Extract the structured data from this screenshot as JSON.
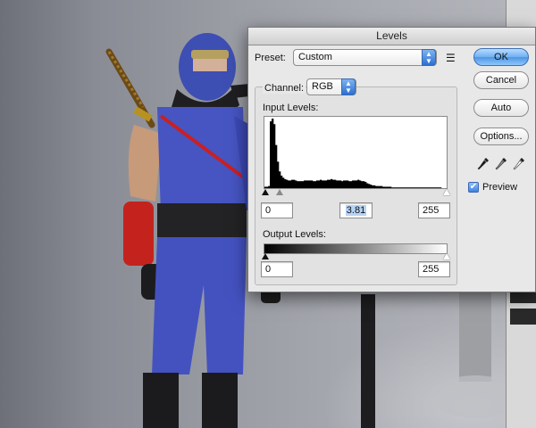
{
  "dialog": {
    "title": "Levels",
    "preset": {
      "label": "Preset:",
      "value": "Custom"
    },
    "channel": {
      "label": "Channel:",
      "value": "RGB"
    },
    "input_levels": {
      "label": "Input Levels:",
      "shadow": "0",
      "midtone": "3.81",
      "highlight": "255"
    },
    "output_levels": {
      "label": "Output Levels:",
      "shadow": "0",
      "highlight": "255"
    },
    "buttons": {
      "ok": "OK",
      "cancel": "Cancel",
      "auto": "Auto",
      "options": "Options..."
    },
    "preview": {
      "label": "Preview",
      "checked": true
    },
    "icons": {
      "preset_menu": "list-menu-icon",
      "popup_arrows": "updown-arrows-icon",
      "droppers": [
        "black-eyedropper-icon",
        "gray-eyedropper-icon",
        "white-eyedropper-icon"
      ]
    }
  },
  "histogram": {
    "bins": [
      2,
      2,
      3,
      96,
      100,
      92,
      62,
      38,
      24,
      18,
      15,
      13,
      12,
      11,
      11,
      12,
      12,
      11,
      10,
      10,
      10,
      10,
      11,
      11,
      11,
      11,
      11,
      10,
      10,
      11,
      11,
      12,
      11,
      11,
      11,
      12,
      12,
      13,
      12,
      12,
      11,
      11,
      11,
      10,
      11,
      11,
      11,
      10,
      10,
      11,
      11,
      11,
      12,
      11,
      10,
      10,
      9,
      7,
      6,
      5,
      4,
      4,
      3,
      3,
      3,
      3,
      2,
      2,
      2,
      2,
      2,
      1,
      1,
      1,
      1,
      1,
      1,
      1,
      1,
      1,
      1,
      1,
      1,
      1,
      1,
      1,
      1,
      1,
      1,
      1,
      1,
      1,
      1,
      1,
      1,
      1,
      1,
      1,
      1,
      0,
      0,
      0
    ]
  },
  "colors": {
    "accent": "#4e95e6",
    "dialog_bg": "#e8e8e8"
  }
}
